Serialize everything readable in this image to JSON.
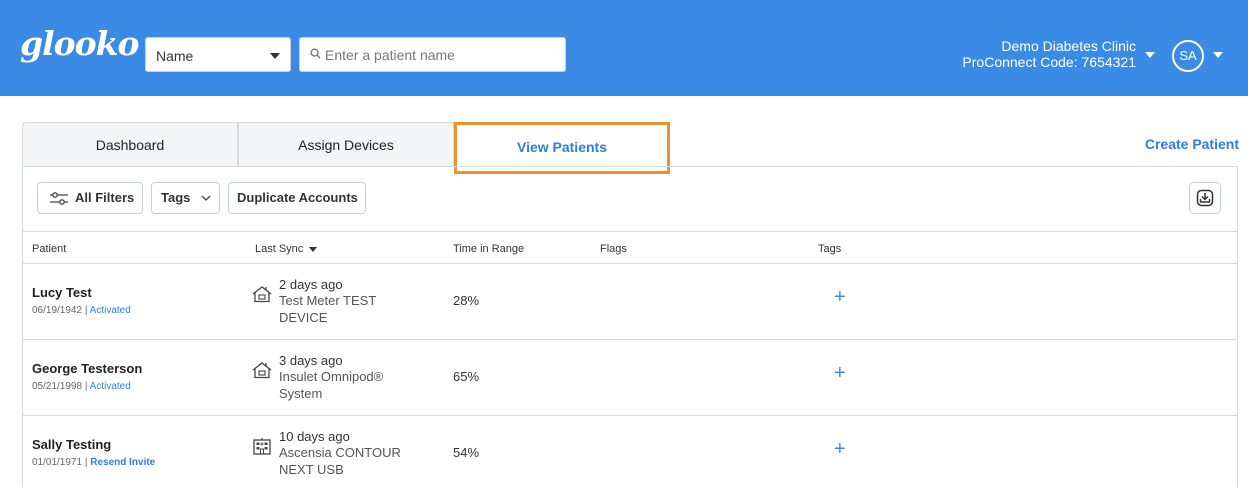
{
  "header": {
    "logo": "glooko",
    "search_type": "Name",
    "search_placeholder": "Enter a patient name",
    "clinic_name": "Demo Diabetes Clinic",
    "proconnect": "ProConnect Code: 7654321",
    "avatar_initials": "SA",
    "bg_color": "#3a8be6"
  },
  "tabs": [
    {
      "label": "Dashboard",
      "active": false
    },
    {
      "label": "Assign Devices",
      "active": false
    },
    {
      "label": "View Patients",
      "active": true
    }
  ],
  "create_patient": "Create Patient",
  "toolbar": {
    "all_filters": "All Filters",
    "tags": "Tags",
    "duplicate_accounts": "Duplicate Accounts"
  },
  "table": {
    "columns": {
      "patient": "Patient",
      "last_sync": "Last Sync",
      "time_in_range": "Time in Range",
      "flags": "Flags",
      "tags": "Tags"
    },
    "rows": [
      {
        "name": "Lucy Test",
        "dob": "06/19/1942",
        "separator": " | ",
        "status": "Activated",
        "sync_when": "2 days ago",
        "device": "Test Meter TEST DEVICE",
        "device_icon": "home-icon",
        "time_in_range": "28%",
        "tag_add": "+"
      },
      {
        "name": "George Testerson",
        "dob": "05/21/1998",
        "separator": " | ",
        "status": "Activated",
        "sync_when": "3 days ago",
        "device": "Insulet Omnipod® System",
        "device_icon": "home-icon",
        "time_in_range": "65%",
        "tag_add": "+"
      },
      {
        "name": "Sally Testing",
        "dob": "01/01/1971",
        "separator": " | ",
        "status": "Resend Invite",
        "sync_when": "10 days ago",
        "device": "Ascensia CONTOUR NEXT USB",
        "device_icon": "clinic-building-icon",
        "time_in_range": "54%",
        "tag_add": "+"
      }
    ]
  },
  "colors": {
    "accent": "#2f7fd8",
    "highlight_border": "#f0902e"
  }
}
